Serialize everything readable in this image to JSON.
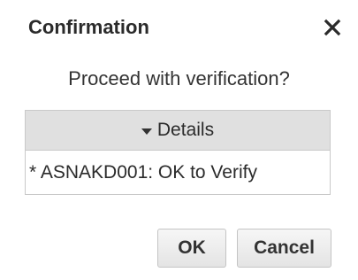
{
  "dialog": {
    "title": "Confirmation",
    "message": "Proceed with verification?",
    "details": {
      "header_label": "Details",
      "items": [
        "* ASNAKD001: OK to Verify"
      ]
    },
    "buttons": {
      "ok_label": "OK",
      "cancel_label": "Cancel"
    },
    "icons": {
      "close": "close-icon",
      "expand": "caret-down-icon"
    }
  }
}
